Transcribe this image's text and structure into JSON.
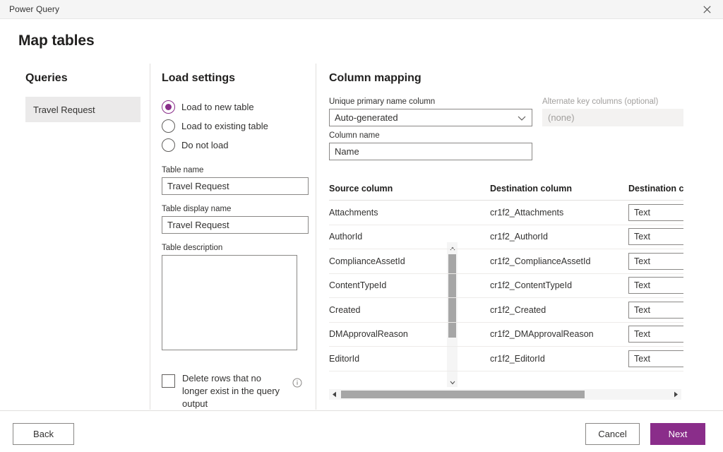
{
  "window": {
    "app_title": "Power Query",
    "close_icon": "close-icon"
  },
  "page": {
    "title": "Map tables"
  },
  "queries": {
    "heading": "Queries",
    "items": [
      {
        "label": "Travel Request",
        "selected": true
      }
    ]
  },
  "load_settings": {
    "heading": "Load settings",
    "radios": [
      {
        "label": "Load to new table",
        "checked": true
      },
      {
        "label": "Load to existing table",
        "checked": false
      },
      {
        "label": "Do not load",
        "checked": false
      }
    ],
    "table_name": {
      "label": "Table name",
      "value": "Travel Request",
      "placeholder": ""
    },
    "table_display_name": {
      "label": "Table display name",
      "value": "Travel Request",
      "placeholder": ""
    },
    "table_description": {
      "label": "Table description",
      "value": "",
      "placeholder": ""
    },
    "delete_rows_checkbox": {
      "label": "Delete rows that no longer exist in the query output",
      "checked": false,
      "info_icon": "info-icon"
    },
    "scrollbar": {
      "up_icon": "chevron-up-icon",
      "down_icon": "chevron-down-icon"
    }
  },
  "column_mapping": {
    "heading": "Column mapping",
    "unique_primary_name_column": {
      "label": "Unique primary name column",
      "value": "Auto-generated",
      "chevron_icon": "chevron-down-icon"
    },
    "alternate_key_columns": {
      "label": "Alternate key columns (optional)",
      "value": "(none)",
      "disabled": true
    },
    "column_name": {
      "label": "Column name",
      "value": "Name",
      "placeholder": ""
    },
    "table": {
      "headers": [
        "Source column",
        "Destination column",
        "Destination co"
      ],
      "rows": [
        {
          "source": "Attachments",
          "destination": "cr1f2_Attachments",
          "type": "Text"
        },
        {
          "source": "AuthorId",
          "destination": "cr1f2_AuthorId",
          "type": "Text"
        },
        {
          "source": "ComplianceAssetId",
          "destination": "cr1f2_ComplianceAssetId",
          "type": "Text"
        },
        {
          "source": "ContentTypeId",
          "destination": "cr1f2_ContentTypeId",
          "type": "Text"
        },
        {
          "source": "Created",
          "destination": "cr1f2_Created",
          "type": "Text"
        },
        {
          "source": "DMApprovalReason",
          "destination": "cr1f2_DMApprovalReason",
          "type": "Text"
        },
        {
          "source": "EditorId",
          "destination": "cr1f2_EditorId",
          "type": "Text"
        }
      ]
    },
    "hscrollbar": {
      "left_icon": "arrow-left-icon",
      "right_icon": "arrow-right-icon"
    }
  },
  "footer": {
    "back_label": "Back",
    "cancel_label": "Cancel",
    "next_label": "Next"
  },
  "colors": {
    "accent": "#8a2d8a",
    "divider": "#e1dfdd",
    "selected_item_bg": "#ebeaea"
  }
}
